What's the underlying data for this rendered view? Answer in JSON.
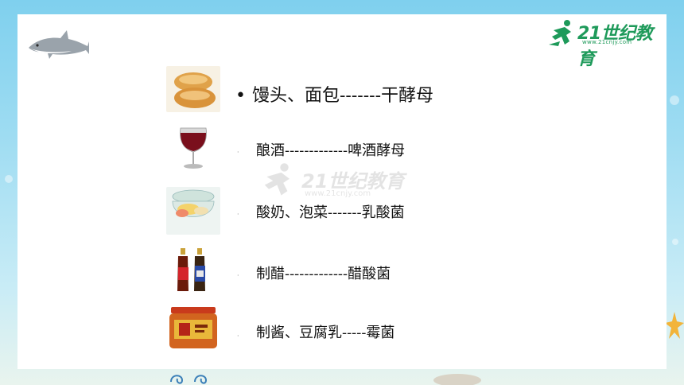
{
  "header": {
    "logo_text": "21世纪教育",
    "logo_url": "www.21cnjy.com"
  },
  "watermark": {
    "text": "21世纪教育",
    "url": "www.21cnjy.com"
  },
  "items": [
    {
      "image": "bread-image",
      "text": "馒头、面包-------干酵母",
      "bullet": "•"
    },
    {
      "image": "red-wine-image",
      "text": "酿酒-------------啤酒酵母",
      "bullet": "·"
    },
    {
      "image": "yogurt-pickle-image",
      "text": "酸奶、泡菜-------乳酸菌",
      "bullet": "·"
    },
    {
      "image": "vinegar-bottles-image",
      "text": "制醋-------------醋酸菌",
      "bullet": "·"
    },
    {
      "image": "sauce-jar-image",
      "text": "制酱、豆腐乳-----霉菌",
      "bullet": "·"
    }
  ],
  "colors": {
    "logo_green": "#1e9a5a",
    "background_blue": "#7fd0ee"
  }
}
